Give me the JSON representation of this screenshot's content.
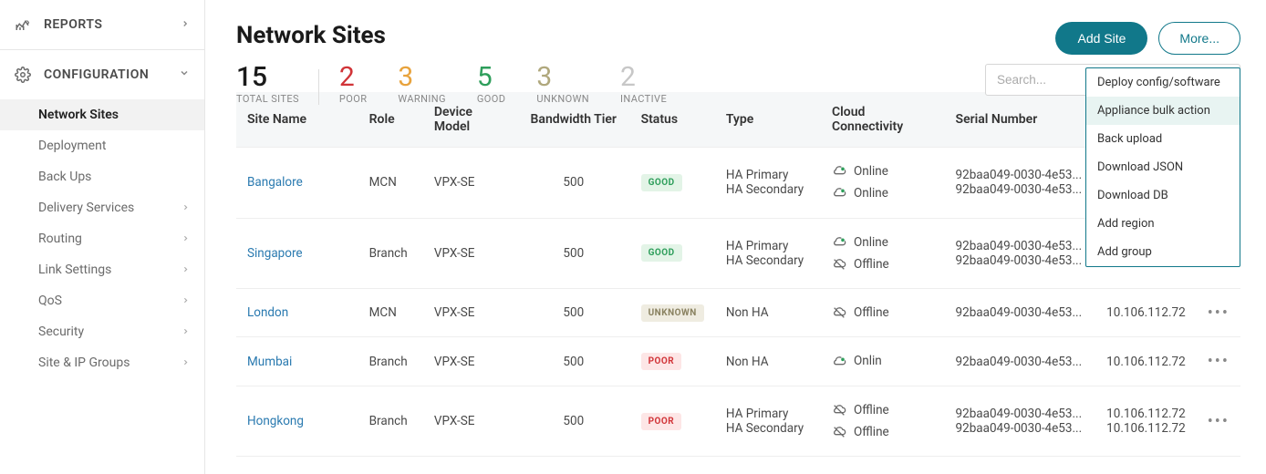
{
  "sidebar": {
    "reports_label": "REPORTS",
    "config_label": "CONFIGURATION",
    "items": [
      {
        "label": "Network Sites",
        "active": true
      },
      {
        "label": "Deployment"
      },
      {
        "label": "Back Ups"
      },
      {
        "label": "Delivery Services",
        "expand": true
      },
      {
        "label": "Routing",
        "expand": true
      },
      {
        "label": "Link Settings",
        "expand": true
      },
      {
        "label": "QoS",
        "expand": true
      },
      {
        "label": "Security",
        "expand": true
      },
      {
        "label": "Site & IP Groups",
        "expand": true
      }
    ]
  },
  "page": {
    "title": "Network Sites",
    "add_site": "Add Site",
    "more": "More..."
  },
  "stats": {
    "total_num": "15",
    "total_label": "TOTAL SITES",
    "poor_num": "2",
    "poor_label": "POOR",
    "warn_num": "3",
    "warn_label": "WARNING",
    "good_num": "5",
    "good_label": "GOOD",
    "unk_num": "3",
    "unk_label": "UNKNOWN",
    "inact_num": "2",
    "inact_label": "INACTIVE"
  },
  "search": {
    "placeholder": "Search..."
  },
  "columns": {
    "site": "Site Name",
    "role": "Role",
    "model": "Device Model",
    "bw": "Bandwidth Tier",
    "status": "Status",
    "type": "Type",
    "conn": "Cloud Connectivity",
    "serial": "Serial Number"
  },
  "rows": [
    {
      "site": "Bangalore",
      "role": "MCN",
      "model": "VPX-SE",
      "bw": "500",
      "status": "GOOD",
      "status_class": "good",
      "type": [
        "HA Primary",
        "HA Secondary"
      ],
      "conn": [
        {
          "state": "Online",
          "on": true
        },
        {
          "state": "Online",
          "on": true
        }
      ],
      "serial": [
        "92baa049-0030-4e53...",
        "92baa049-0030-4e53..."
      ],
      "mgmt": []
    },
    {
      "site": "Singapore",
      "role": "Branch",
      "model": "VPX-SE",
      "bw": "500",
      "status": "GOOD",
      "status_class": "good",
      "type": [
        "HA Primary",
        "HA Secondary"
      ],
      "conn": [
        {
          "state": "Online",
          "on": true
        },
        {
          "state": "Offline",
          "on": false
        }
      ],
      "serial": [
        "92baa049-0030-4e53...",
        "92baa049-0030-4e53..."
      ],
      "mgmt": []
    },
    {
      "site": "London",
      "role": "MCN",
      "model": "VPX-SE",
      "bw": "500",
      "status": "UNKNOWN",
      "status_class": "unknown",
      "type": [
        "Non HA"
      ],
      "conn": [
        {
          "state": "Offline",
          "on": false
        }
      ],
      "serial": [
        "92baa049-0030-4e53..."
      ],
      "mgmt": [
        "10.106.112.72"
      ]
    },
    {
      "site": "Mumbai",
      "role": "Branch",
      "model": "VPX-SE",
      "bw": "500",
      "status": "POOR",
      "status_class": "poor",
      "type": [
        "Non HA"
      ],
      "conn": [
        {
          "state": "Onlin",
          "on": true
        }
      ],
      "serial": [
        "92baa049-0030-4e53..."
      ],
      "mgmt": [
        "10.106.112.72"
      ]
    },
    {
      "site": "Hongkong",
      "role": "Branch",
      "model": "VPX-SE",
      "bw": "500",
      "status": "POOR",
      "status_class": "poor",
      "type": [
        "HA Primary",
        "HA Secondary"
      ],
      "conn": [
        {
          "state": "Offline",
          "on": false
        },
        {
          "state": "Offline",
          "on": false
        }
      ],
      "serial": [
        "92baa049-0030-4e53...",
        "92baa049-0030-4e53..."
      ],
      "mgmt": [
        "10.106.112.72",
        "10.106.112.72"
      ]
    }
  ],
  "dropdown": {
    "items": [
      {
        "label": "Deploy config/software"
      },
      {
        "label": "Appliance bulk action",
        "hover": true
      },
      {
        "label": "Back upload"
      },
      {
        "label": "Download JSON"
      },
      {
        "label": "Download DB"
      },
      {
        "label": "Add region"
      },
      {
        "label": "Add group"
      }
    ]
  }
}
